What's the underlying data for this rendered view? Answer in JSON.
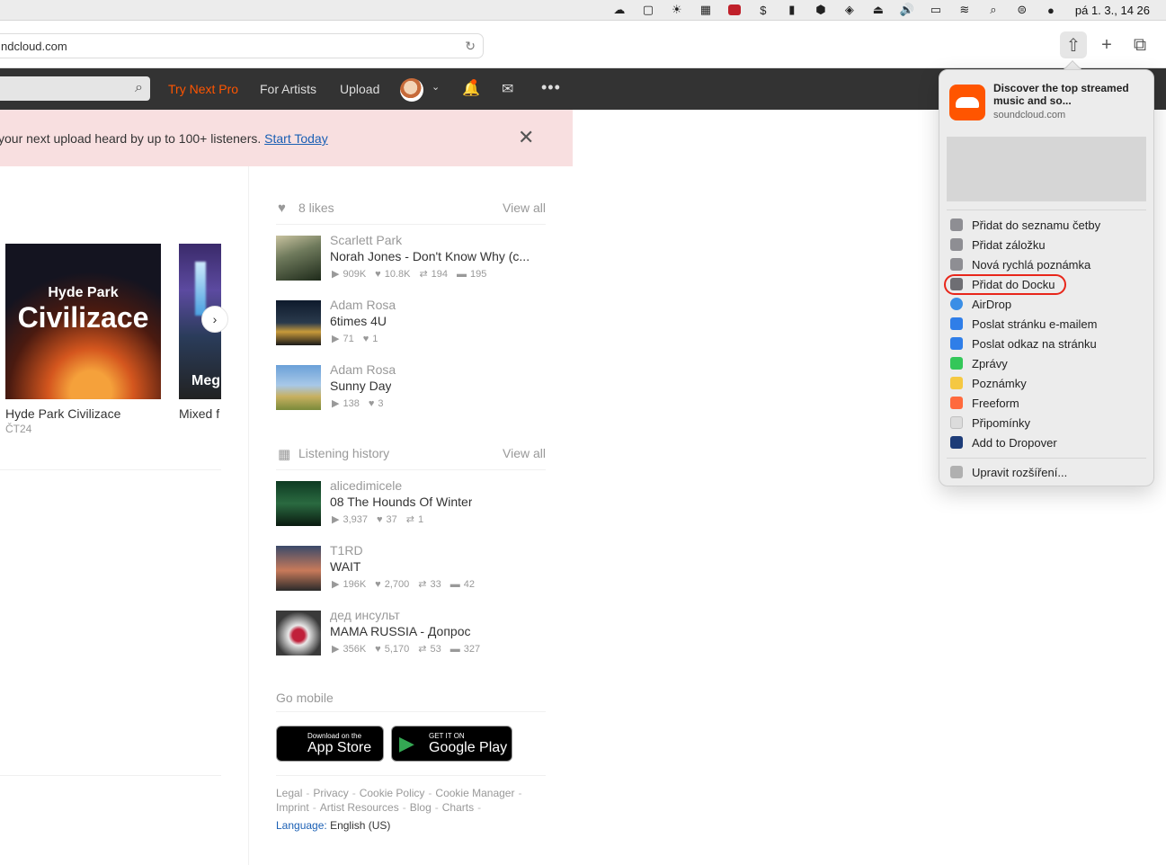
{
  "menubar": {
    "clock": "pá 1. 3., 14 26"
  },
  "toolbar": {
    "url": "ndcloud.com"
  },
  "header": {
    "try_next_pro": "Try Next Pro",
    "for_artists": "For Artists",
    "upload": "Upload"
  },
  "banner": {
    "text": "your next upload heard by up to 100+ listeners.",
    "link": "Start Today"
  },
  "cards": [
    {
      "art_line1": "Hyde Park",
      "art_line2": "Civilizace",
      "title": "Hyde Park Civilizace",
      "subtitle": "ČT24"
    },
    {
      "art_text": "Meg",
      "title": "Mixed f"
    }
  ],
  "likes": {
    "label": "8 likes",
    "view_all": "View all",
    "tracks": [
      {
        "artist": "Scarlett Park",
        "title": "Norah Jones - Don't Know Why (c...",
        "plays": "909K",
        "likes": "10.8K",
        "reposts": "194",
        "comments": "195"
      },
      {
        "artist": "Adam Rosa",
        "title": "6times 4U",
        "plays": "71",
        "likes": "1"
      },
      {
        "artist": "Adam Rosa",
        "title": "Sunny Day",
        "plays": "138",
        "likes": "3"
      }
    ]
  },
  "history": {
    "label": "Listening history",
    "view_all": "View all",
    "tracks": [
      {
        "artist": "alicedimicele",
        "title": "08 The Hounds Of Winter",
        "plays": "3,937",
        "likes": "37",
        "reposts": "1"
      },
      {
        "artist": "T1RD",
        "title": "WAIT",
        "plays": "196K",
        "likes": "2,700",
        "reposts": "33",
        "comments": "42"
      },
      {
        "artist": "дед инсульт",
        "title": "MAMA RUSSIA - Допрос",
        "plays": "356K",
        "likes": "5,170",
        "reposts": "53",
        "comments": "327"
      }
    ]
  },
  "go_mobile": {
    "label": "Go mobile",
    "apple_small": "Download on the",
    "apple_big": "App Store",
    "google_small": "GET IT ON",
    "google_big": "Google Play"
  },
  "footer": {
    "links": [
      "Legal",
      "Privacy",
      "Cookie Policy",
      "Cookie Manager",
      "Imprint",
      "Artist Resources",
      "Blog",
      "Charts"
    ],
    "language_key": "Language:",
    "language_value": "English (US)"
  },
  "share_menu": {
    "title": "Discover the top streamed music and so...",
    "site": "soundcloud.com",
    "items": [
      {
        "label": "Přidat do seznamu četby",
        "color": "#8e8e93"
      },
      {
        "label": "Přidat záložku",
        "color": "#8e8e93"
      },
      {
        "label": "Nová rychlá poznámka",
        "color": "#8e8e93"
      },
      {
        "label": "Přidat do Docku",
        "color": "#6e6e73"
      },
      {
        "label": "AirDrop",
        "color": "#3a8ee6"
      },
      {
        "label": "Poslat stránku e-mailem",
        "color": "#2f7ee8"
      },
      {
        "label": "Poslat odkaz na stránku",
        "color": "#2f7ee8"
      },
      {
        "label": "Zprávy",
        "color": "#34c759"
      },
      {
        "label": "Poznámky",
        "color": "#f5c842"
      },
      {
        "label": "Freeform",
        "color": "#ff6a3d"
      },
      {
        "label": "Připomínky",
        "color": "#dcdcdc"
      },
      {
        "label": "Add to Dropover",
        "color": "#1d3c78"
      }
    ],
    "edit": "Upravit rozšíření..."
  }
}
